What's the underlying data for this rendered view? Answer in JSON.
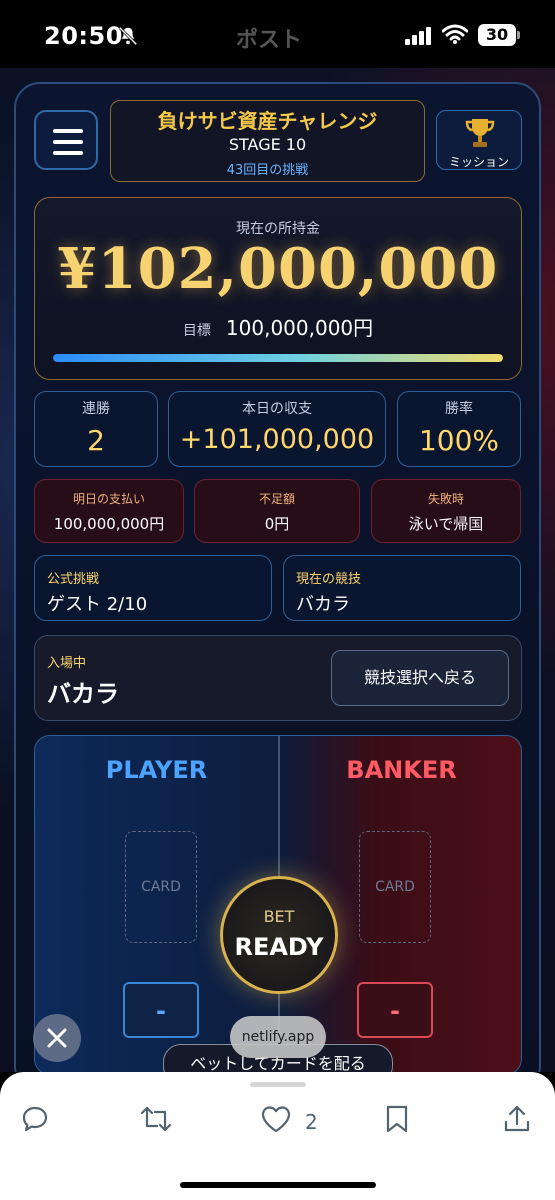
{
  "status_bar": {
    "time": "20:50",
    "title": "ポスト",
    "battery": "30"
  },
  "header": {
    "title": "負けサビ資産チャレンジ",
    "stage": "STAGE 10",
    "attempt": "43回目の挑戦",
    "mission_label": "ミッション"
  },
  "money": {
    "label": "現在の所持金",
    "value": "¥102,000,000",
    "goal_label": "目標",
    "goal_value": "100,000,000円",
    "progress": 1.0
  },
  "stats": [
    {
      "label": "連勝",
      "value": "2"
    },
    {
      "label": "本日の収支",
      "value": "+101,000,000"
    },
    {
      "label": "勝率",
      "value": "100%"
    }
  ],
  "warnings": [
    {
      "label": "明日の支払い",
      "value": "100,000,000円"
    },
    {
      "label": "不足額",
      "value": "0円"
    },
    {
      "label": "失敗時",
      "value": "泳いで帰国"
    }
  ],
  "info": [
    {
      "label": "公式挑戦",
      "value": "ゲスト 2/10"
    },
    {
      "label": "現在の競技",
      "value": "バカラ"
    }
  ],
  "venue": {
    "label": "入場中",
    "value": "バカラ",
    "back_button": "競技選択へ戻る"
  },
  "table": {
    "player_title": "PLAYER",
    "banker_title": "BANKER",
    "card_label": "CARD",
    "bet_small": "BET",
    "bet_big": "READY",
    "player_score": "-",
    "banker_score": "-",
    "deal_button": "ベットしてカードを配る"
  },
  "browser": {
    "url": "netlify.app"
  },
  "actions": {
    "like_count": "2"
  },
  "colors": {
    "gold": "#f7d270",
    "player_blue": "#4da3ff",
    "banker_red": "#ff5a66"
  }
}
